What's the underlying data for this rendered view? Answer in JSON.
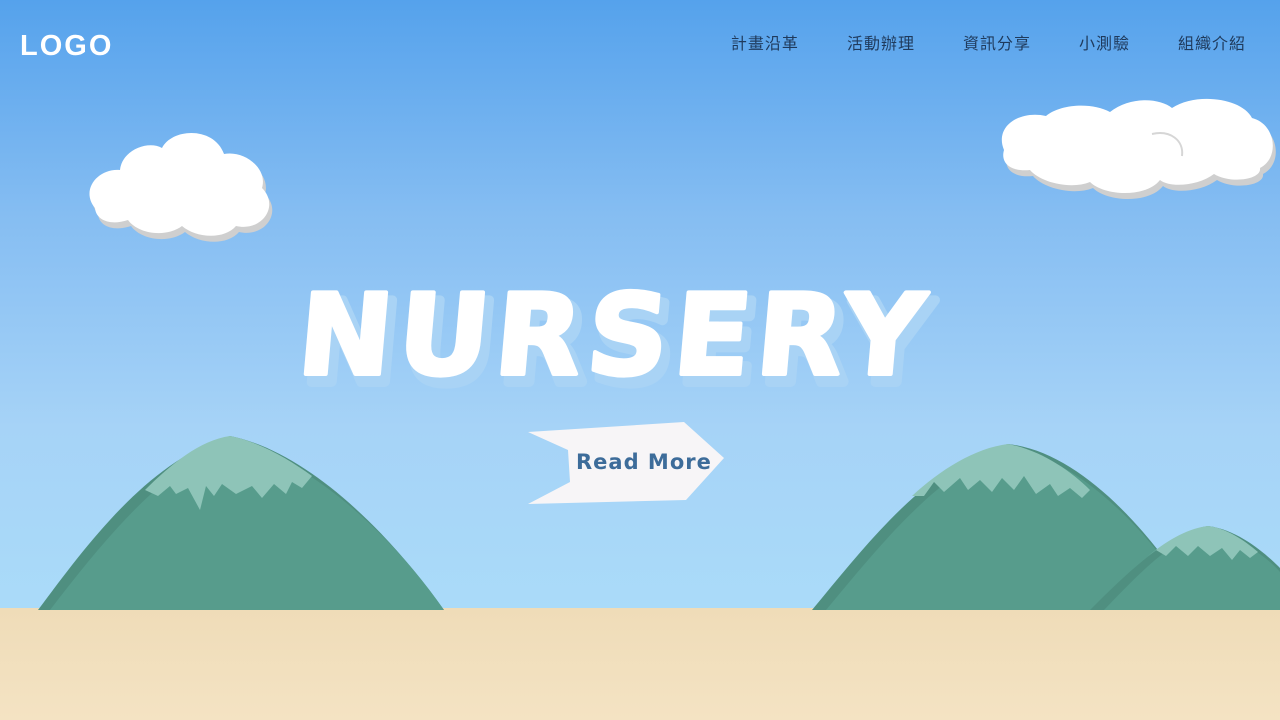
{
  "header": {
    "logo": "LOGO",
    "nav": [
      {
        "label": "計畫沿革"
      },
      {
        "label": "活動辦理"
      },
      {
        "label": "資訊分享"
      },
      {
        "label": "小測驗"
      },
      {
        "label": "組織介紹"
      }
    ]
  },
  "hero": {
    "title": "NURSERY",
    "cta_label": "Read More"
  },
  "colors": {
    "sky_top": "#55a2ec",
    "sky_bottom": "#aadbf9",
    "ground": "#f2e1bf",
    "mountain": "#579c8c",
    "mountain_light": "#8ec4b8",
    "cta_text": "#3d6c9a",
    "title_shadow": "#a9d3f5"
  }
}
